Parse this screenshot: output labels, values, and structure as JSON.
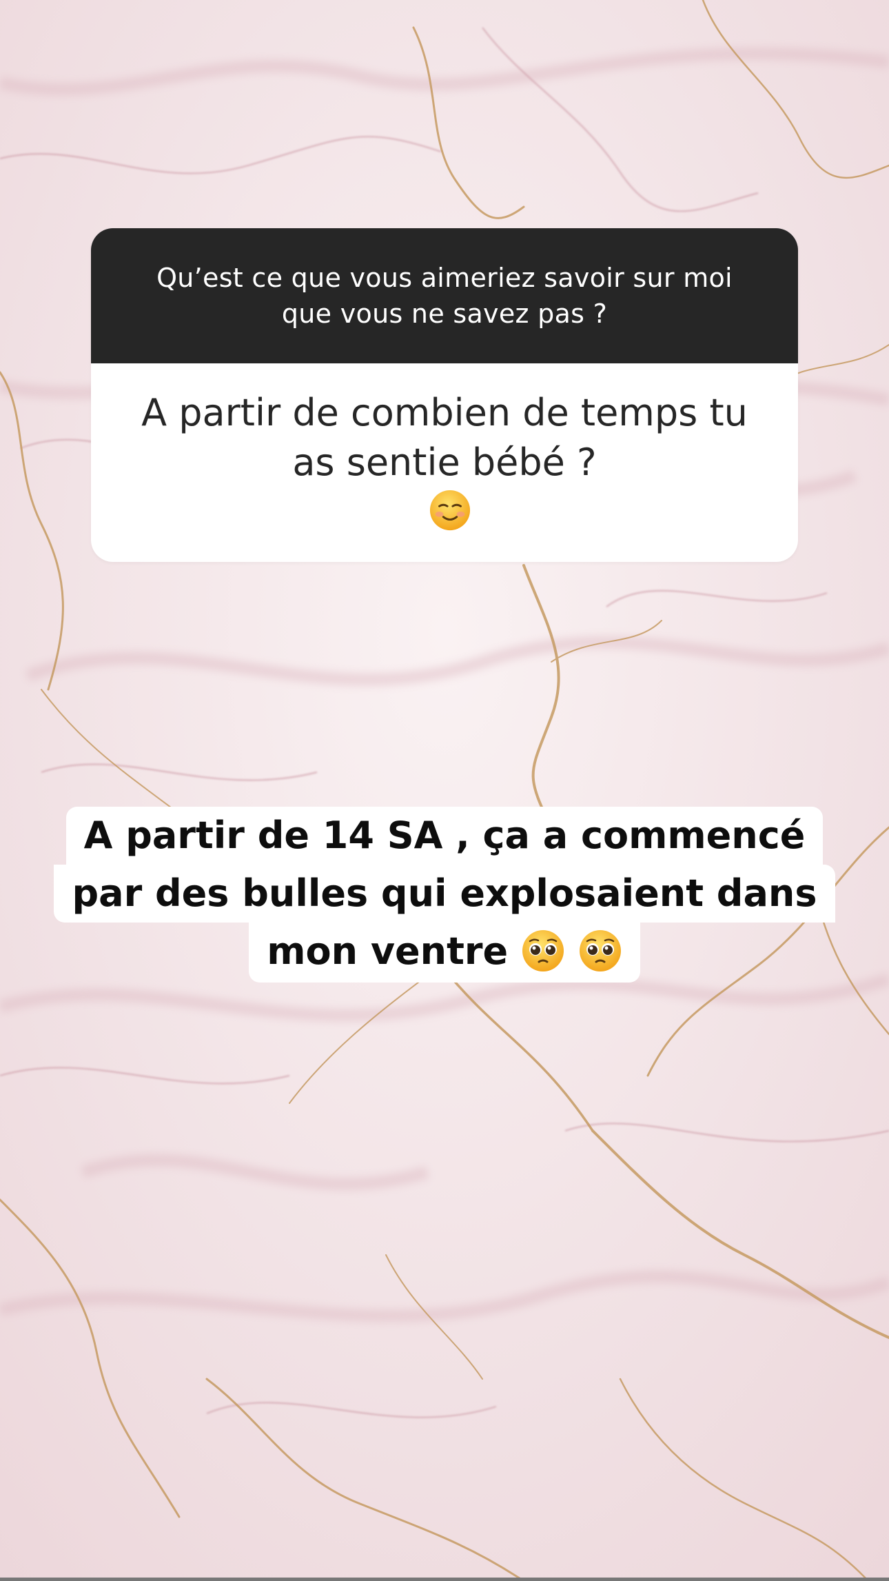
{
  "question_sticker": {
    "prompt": "Qu’est ce que vous aimeriez savoir sur moi\nque vous ne savez pas ?",
    "response": "A partir de combien de temps tu\nas sentie bébé ?"
  },
  "answer_text": {
    "line1": "A partir de 14 SA , ça a commencé",
    "line2": "par des bulles qui explosaient dans",
    "line3": "mon ventre"
  },
  "emojis": {
    "question_emoji": "smiling-face-icon",
    "answer_emojis": [
      "pleading-face-icon",
      "pleading-face-icon"
    ]
  },
  "colors": {
    "sticker_header": "#262626",
    "sticker_body": "#ffffff",
    "answer_highlight": "#ffffff",
    "marble_base": "#f3e6e9",
    "vein_gold": "#c9a06a",
    "vein_rose": "#d8aeb8"
  }
}
